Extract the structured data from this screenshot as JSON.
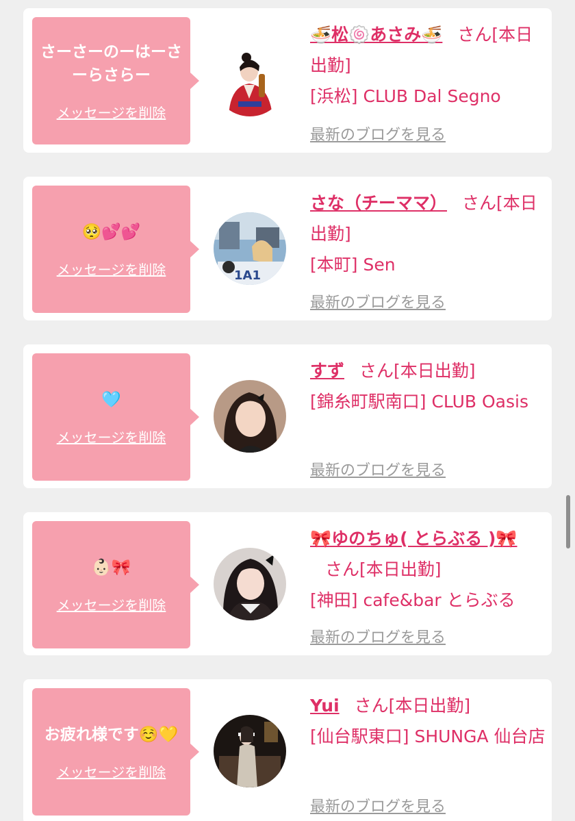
{
  "delete_label": "メッセージを削除",
  "blog_label": "最新のブログを見る",
  "san_label": "さん",
  "colors": {
    "page_bg": "#efefef",
    "bubble": "#f6a0ae",
    "accent": "#de2f66",
    "link_gray": "#9a9a9a"
  },
  "cards": [
    {
      "message": "さーさーのーはーさーらさらー",
      "name": "🍜松🍥あさみ🍜",
      "status": "[本日出勤]",
      "store": "[浜松] CLUB Dal Segno"
    },
    {
      "message": "🥺💕💕",
      "name": "さな（チーママ）",
      "status": "[本日出勤]",
      "store": "[本町] Sen"
    },
    {
      "message": "🩵",
      "name": "すず",
      "status": "[本日出勤]",
      "store": "[錦糸町駅南口] CLUB Oasis"
    },
    {
      "message": "👶🏻🎀",
      "name": "🎀ゆのちゅ( とらぶる )🎀",
      "status": "[本日出勤]",
      "store": "[神田] cafe&bar とらぶる"
    },
    {
      "message": "お疲れ様です☺️💛",
      "name": "Yui",
      "status": "[本日出勤]",
      "store": "[仙台駅東口] SHUNGA 仙台店"
    }
  ]
}
